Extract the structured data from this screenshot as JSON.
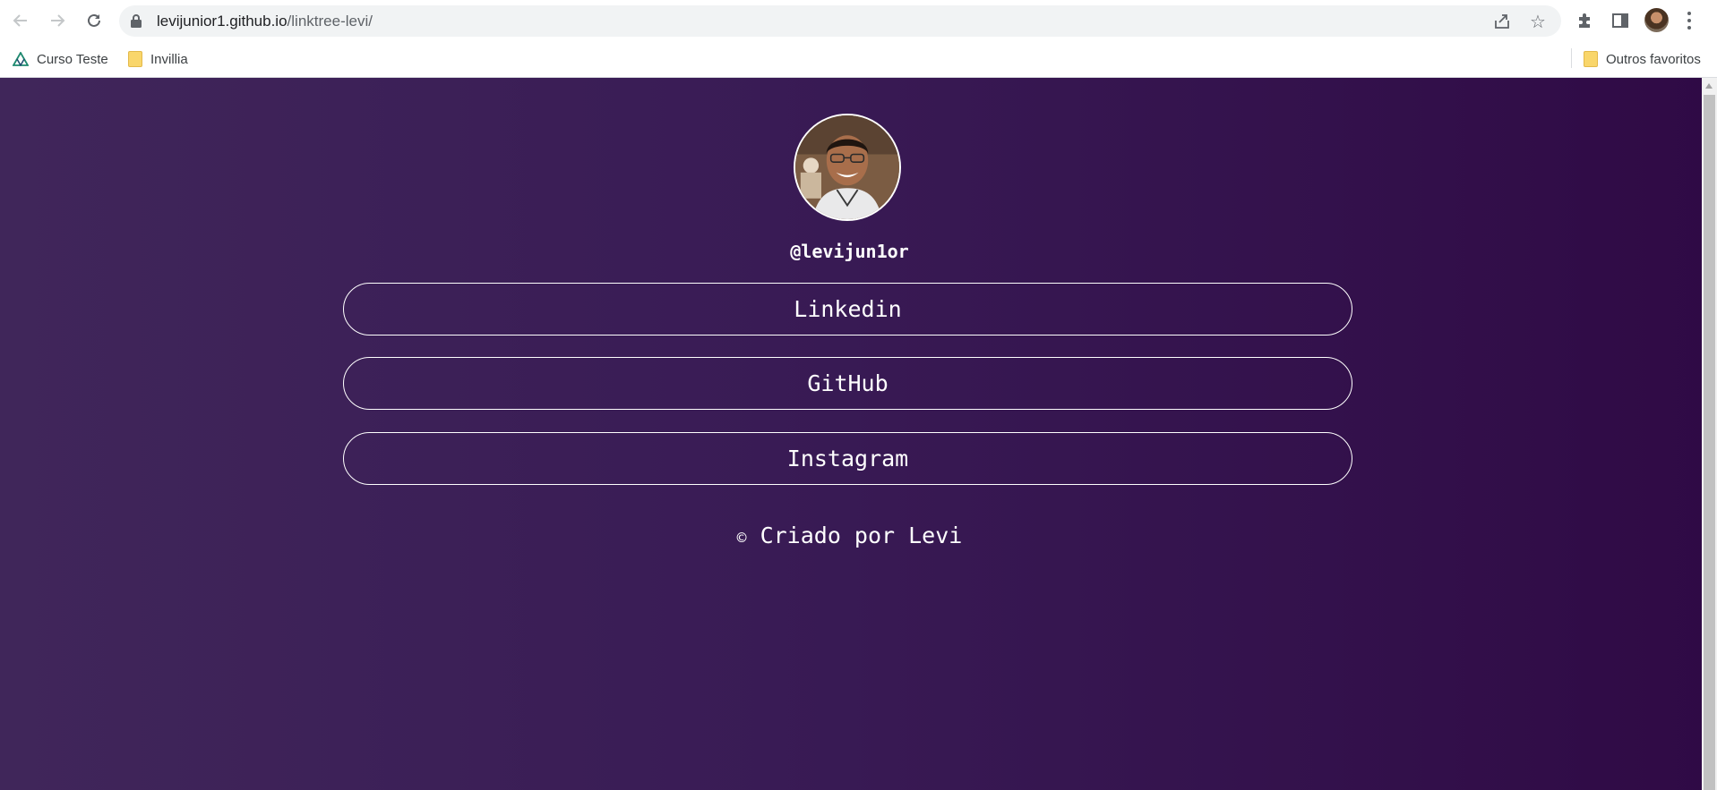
{
  "browser": {
    "url_host": "levijunior1.github.io",
    "url_path": "/linktree-levi/",
    "bookmarks": [
      {
        "label": "Curso Teste",
        "icon": "vuetify-logo-icon"
      },
      {
        "label": "Invillia",
        "icon": "folder-icon"
      }
    ],
    "other_bookmarks": "Outros favoritos"
  },
  "page": {
    "handle": "@levijun1or",
    "links": [
      {
        "label": "Linkedin"
      },
      {
        "label": "GitHub"
      },
      {
        "label": "Instagram"
      }
    ],
    "footer_symbol": "©",
    "footer_text": "Criado por Levi"
  },
  "colors": {
    "background_start": "#40265a",
    "background_end": "#2f0a45",
    "text": "#ffffff"
  }
}
